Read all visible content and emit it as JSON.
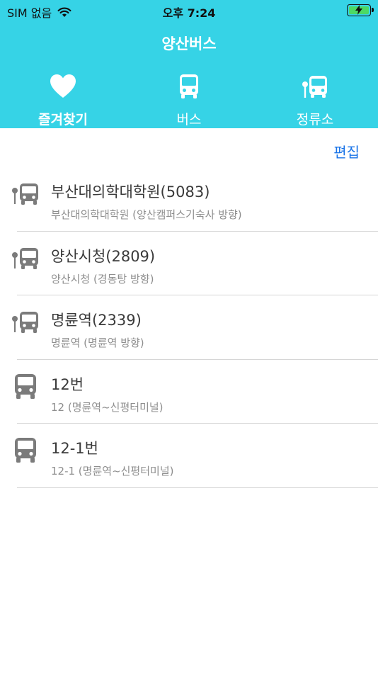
{
  "status_bar": {
    "carrier": "SIM 없음",
    "time": "오후 7:24"
  },
  "header": {
    "title": "양산버스"
  },
  "tabs": [
    {
      "label": "즐겨찾기",
      "icon": "heart-icon",
      "active": true
    },
    {
      "label": "버스",
      "icon": "bus-icon",
      "active": false
    },
    {
      "label": "정류소",
      "icon": "bus-stop-icon",
      "active": false
    }
  ],
  "toolbar": {
    "edit_label": "편집"
  },
  "favorites": [
    {
      "type": "stop",
      "icon": "bus-stop-icon",
      "title": "부산대의학대학원(5083)",
      "subtitle": "부산대의학대학원 (양산캠퍼스기숙사 방향)"
    },
    {
      "type": "stop",
      "icon": "bus-stop-icon",
      "title": "양산시청(2809)",
      "subtitle": "양산시청 (경동탕 방향)"
    },
    {
      "type": "stop",
      "icon": "bus-stop-icon",
      "title": "명륜역(2339)",
      "subtitle": "명륜역 (명륜역 방향)"
    },
    {
      "type": "bus",
      "icon": "bus-icon",
      "title": "12번",
      "subtitle": "12 (명륜역~신평터미널)"
    },
    {
      "type": "bus",
      "icon": "bus-icon",
      "title": "12-1번",
      "subtitle": "12-1 (명륜역~신평터미널)"
    }
  ],
  "colors": {
    "header_bg": "#36d3e6",
    "accent": "#1a74e8",
    "icon_gray": "#7b7b7b",
    "battery_green": "#4cd964"
  }
}
